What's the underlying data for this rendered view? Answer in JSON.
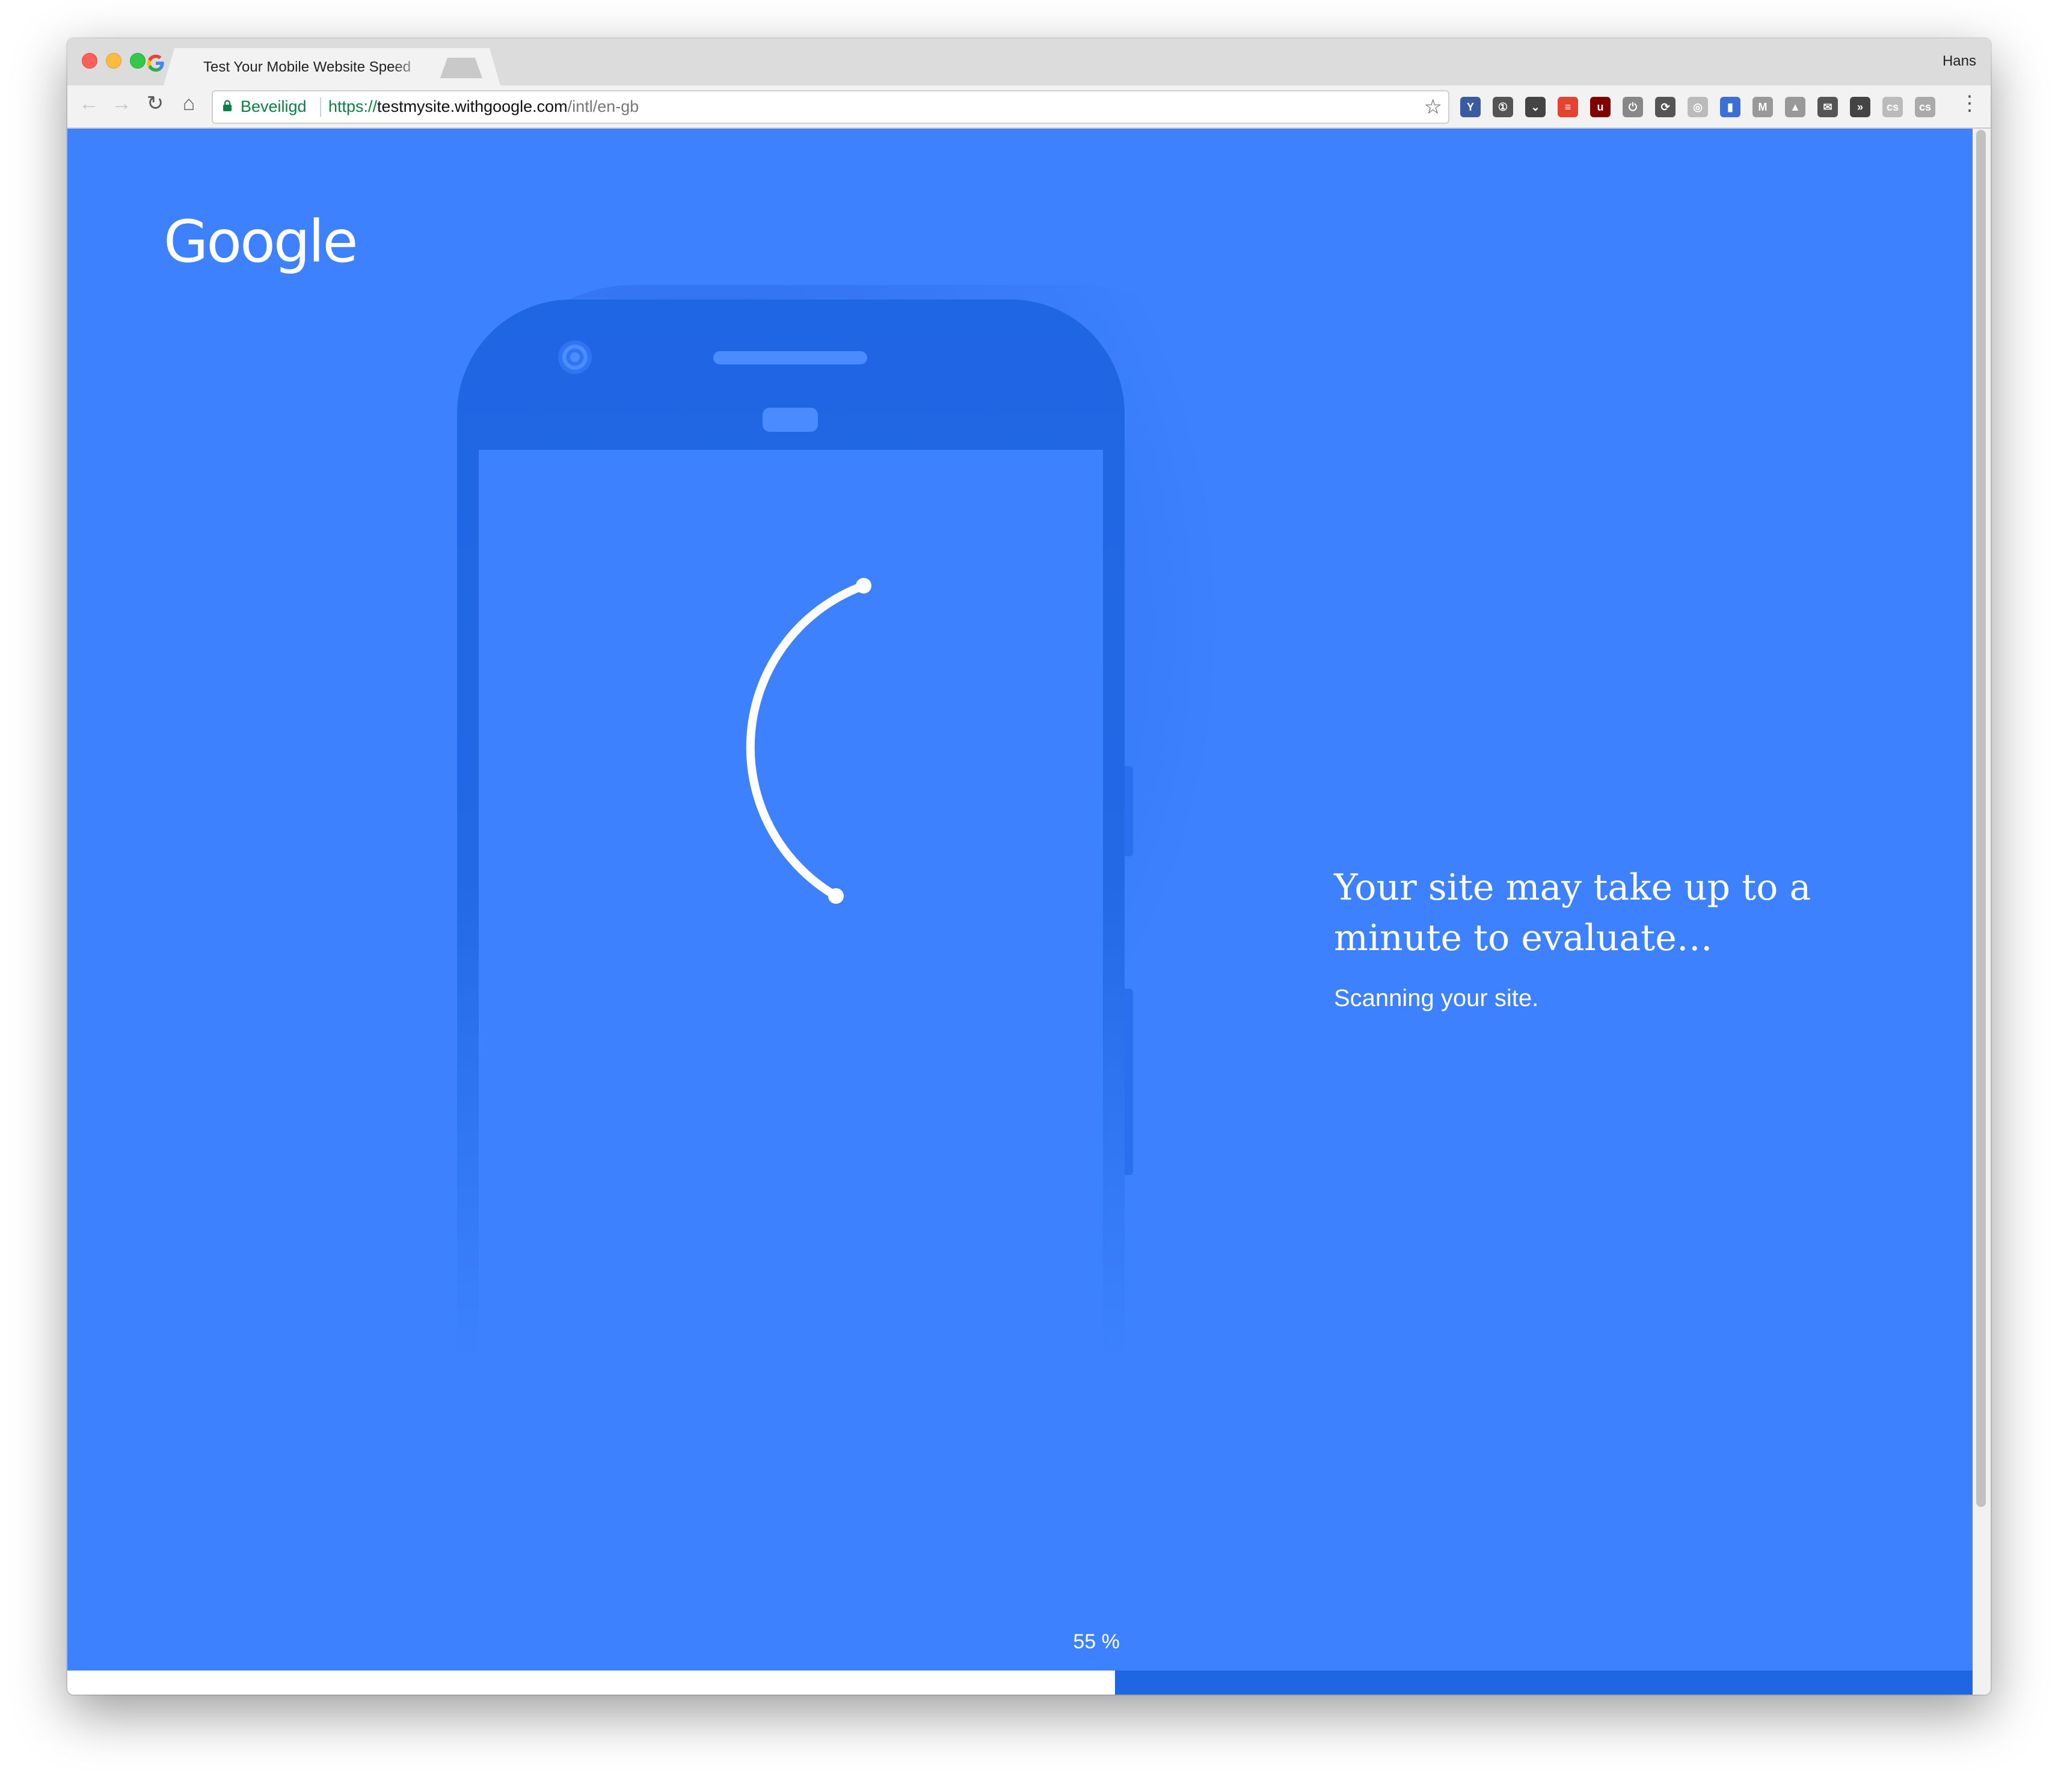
{
  "browser": {
    "tab_title": "Test Your Mobile Website Speed",
    "tab_close": "×",
    "profile_name": "Hans",
    "secure_label": "Beveiligd",
    "url_scheme": "https://",
    "url_host": "testmysite.withgoogle.com",
    "url_path": "/intl/en-gb",
    "icons": {
      "back": "arrow-left-icon",
      "forward": "arrow-right-icon",
      "reload": "reload-icon",
      "home": "home-icon",
      "lock": "lock-icon",
      "bookmark": "star-icon",
      "menu": "kebab-menu-icon"
    },
    "extensions": [
      {
        "name": "vivaldi-extension-icon",
        "glyph": "Y",
        "color": "#3a5ba0"
      },
      {
        "name": "1password-extension-icon",
        "glyph": "①",
        "color": "#555555"
      },
      {
        "name": "pocket-extension-icon",
        "glyph": "⌄",
        "color": "#444444"
      },
      {
        "name": "todoist-extension-icon",
        "glyph": "≡",
        "color": "#e44332"
      },
      {
        "name": "ublock-extension-icon",
        "glyph": "u",
        "color": "#800000"
      },
      {
        "name": "power-extension-icon",
        "glyph": "⏻",
        "color": "#888888"
      },
      {
        "name": "sync-extension-icon",
        "glyph": "⟳",
        "color": "#555555"
      },
      {
        "name": "globe-extension-icon",
        "glyph": "◎",
        "color": "#bbbbbb"
      },
      {
        "name": "stripes-extension-icon",
        "glyph": "▮",
        "color": "#3b6fd4"
      },
      {
        "name": "markdown-extension-icon",
        "glyph": "M",
        "color": "#999999"
      },
      {
        "name": "drive-extension-icon",
        "glyph": "▲",
        "color": "#999999"
      },
      {
        "name": "mail-extension-icon",
        "glyph": "✉",
        "color": "#555555"
      },
      {
        "name": "code-extension-icon",
        "glyph": "»",
        "color": "#444444"
      },
      {
        "name": "cs-extension-icon",
        "glyph": "cs",
        "color": "#bbbbbb"
      },
      {
        "name": "cs-box-extension-icon",
        "glyph": "cs",
        "color": "#aaaaaa"
      }
    ]
  },
  "page": {
    "logo": "Google",
    "heading": "Your site may take up to a minute to evaluate…",
    "status": "Scanning your site.",
    "progress": {
      "value": 55,
      "unit": "%",
      "label": "55 %"
    },
    "colors": {
      "background": "#3d81fe",
      "phone": "#1f66e4",
      "progress_fill": "#ffffff",
      "progress_track": "#1f66e4"
    }
  }
}
